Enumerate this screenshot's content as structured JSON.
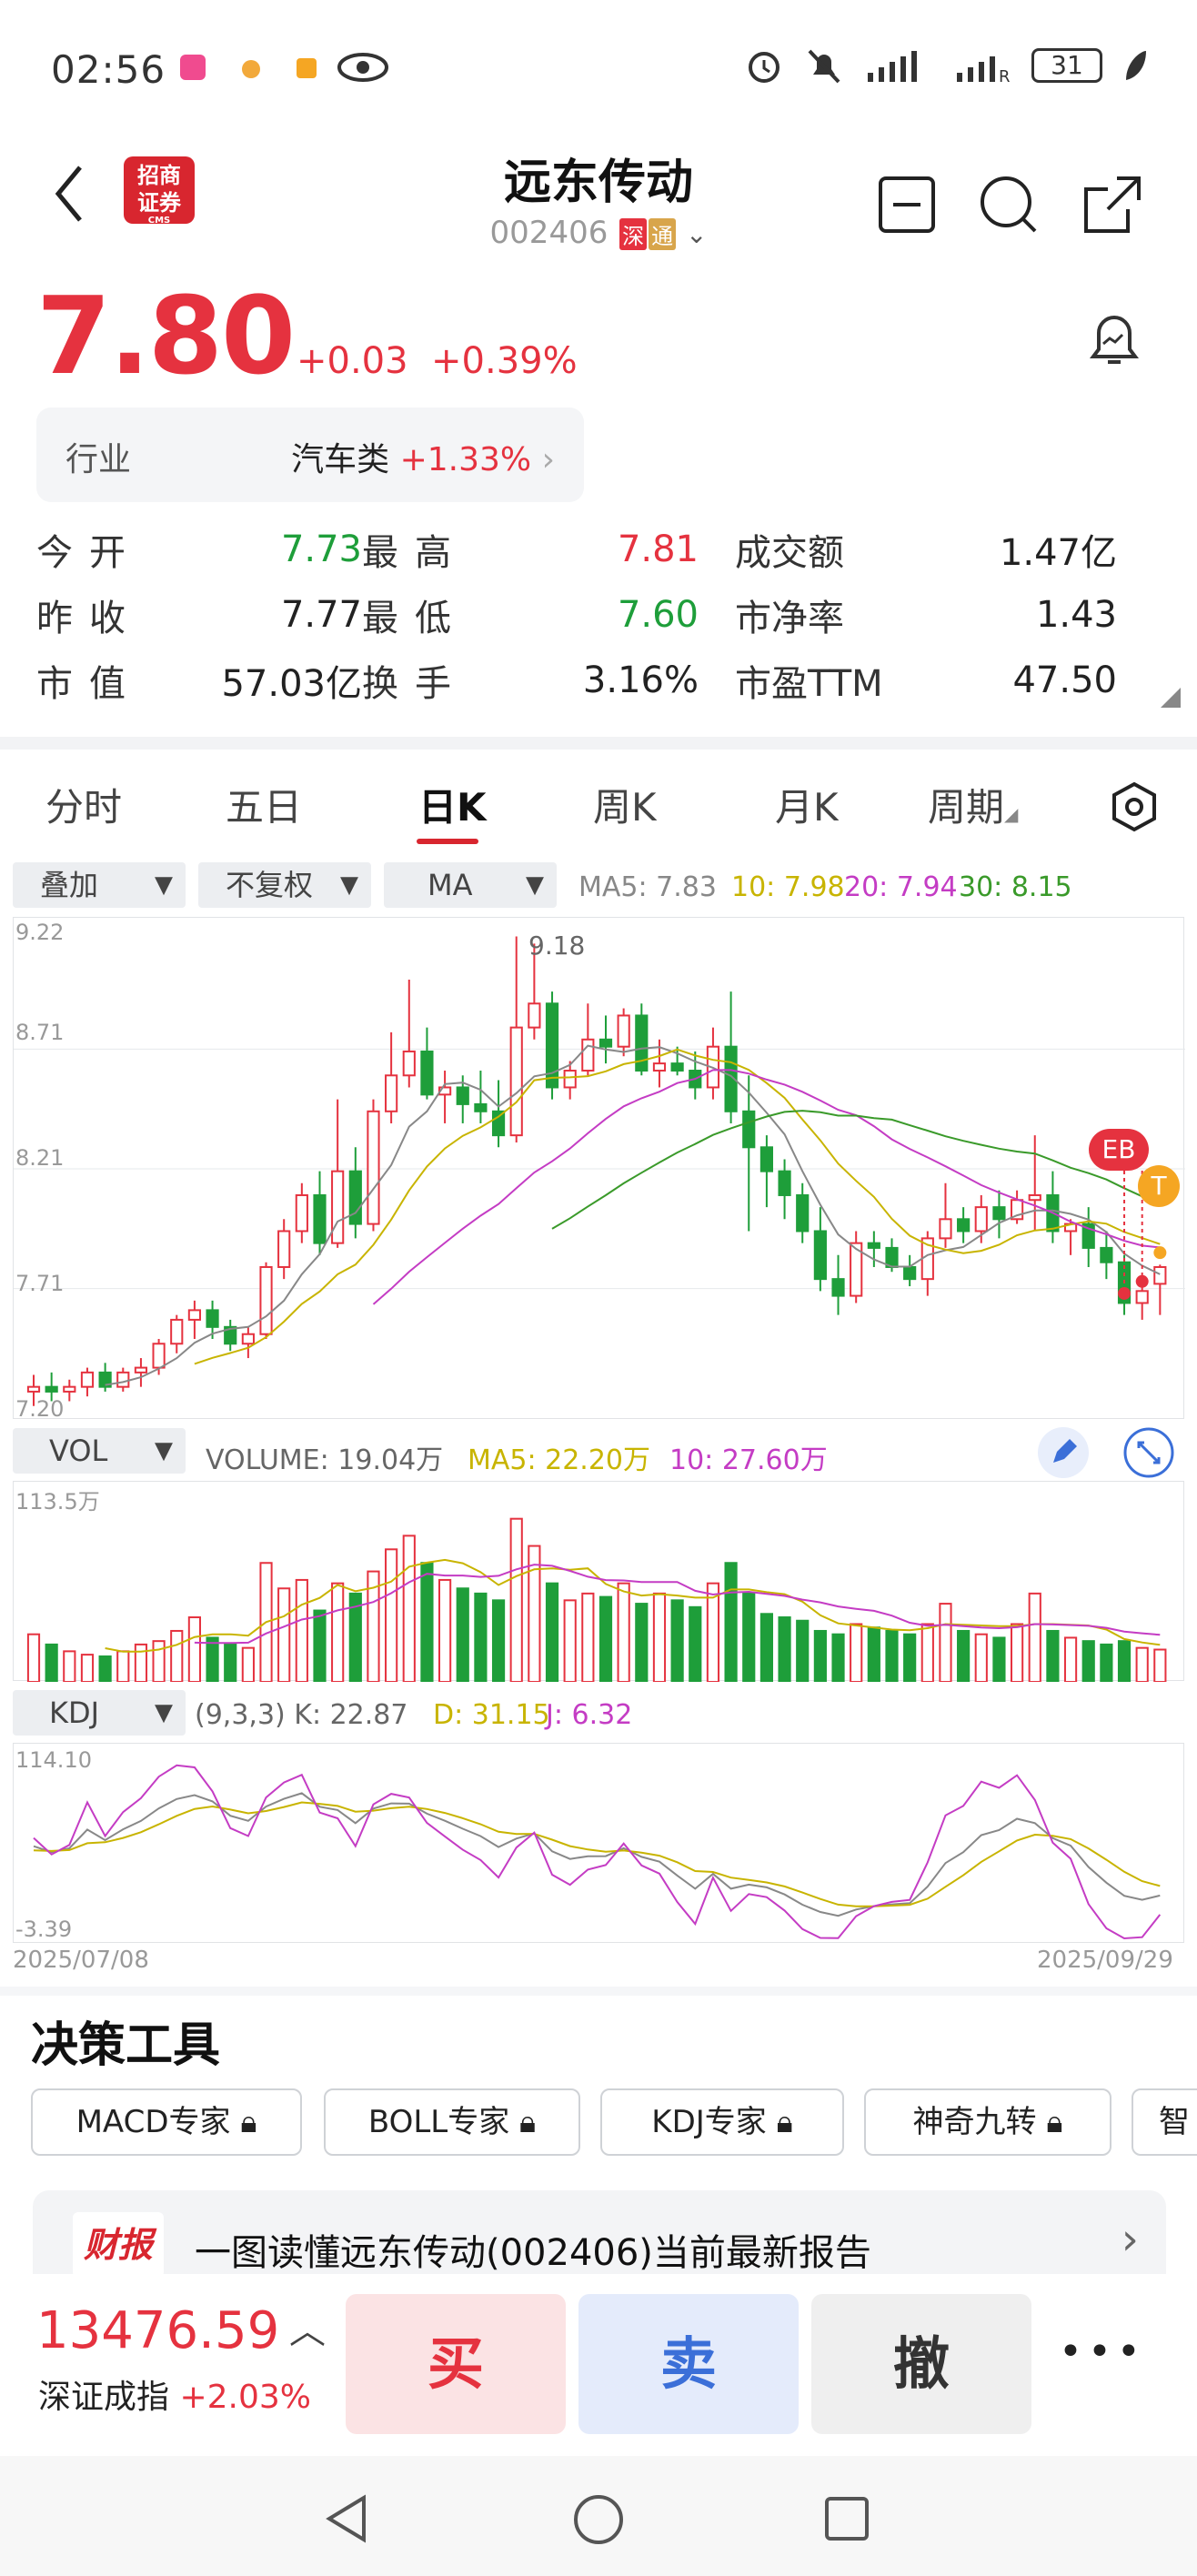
{
  "status_bar": {
    "time": "02:56",
    "battery": "31",
    "signal_label": "R"
  },
  "header": {
    "title": "远东传动",
    "code": "002406",
    "tag_shen": "深",
    "tag_tong": "通",
    "logo_text": "招商证券",
    "logo_sub": "CMS"
  },
  "quote": {
    "price": "7.80",
    "change": "+0.03",
    "change_pct": "+0.39%"
  },
  "industry": {
    "label": "行业",
    "name": "汽车类",
    "pct": "+1.33%"
  },
  "stats": [
    [
      {
        "label": "今开",
        "value": "7.73",
        "color": "green"
      },
      {
        "label": "最高",
        "value": "7.81",
        "color": "red"
      },
      {
        "label": "成交额",
        "value": "1.47亿",
        "color": "dark"
      }
    ],
    [
      {
        "label": "昨收",
        "value": "7.77",
        "color": "dark"
      },
      {
        "label": "最低",
        "value": "7.60",
        "color": "green"
      },
      {
        "label": "市净率",
        "value": "1.43",
        "color": "dark"
      }
    ],
    [
      {
        "label": "市值",
        "value": "57.03亿",
        "color": "dark"
      },
      {
        "label": "换手",
        "value": "3.16%",
        "color": "dark"
      },
      {
        "label": "市盈TTM",
        "value": "47.50",
        "color": "dark"
      }
    ]
  ],
  "tabs": [
    "分时",
    "五日",
    "日K",
    "周K",
    "月K",
    "周期"
  ],
  "chart_controls": {
    "overlay": "叠加",
    "adjust": "不复权",
    "ma": "MA"
  },
  "ma_legend": {
    "ma5": "MA5: 7.83",
    "ma10": "10: 7.98",
    "ma20": "20: 7.94",
    "ma30": "30: 8.15"
  },
  "main_axis": {
    "top": "9.22",
    "l2": "8.71",
    "l3": "8.21",
    "l4": "7.71",
    "bottom": "7.20",
    "peak": "9.18"
  },
  "markers": {
    "eb": "EB",
    "t": "T"
  },
  "vol_legend": {
    "selector": "VOL",
    "volume": "VOLUME: 19.04万",
    "ma5": "MA5: 22.20万",
    "ma10": "10: 27.60万",
    "top": "113.5万"
  },
  "kdj_legend": {
    "selector": "KDJ",
    "params": "(9,3,3) K: 22.87",
    "d": "D: 31.15",
    "j": "J: 6.32",
    "top": "114.10",
    "bottom": "-3.39"
  },
  "dates": {
    "start": "2025/07/08",
    "end": "2025/09/29"
  },
  "tools": {
    "title": "决策工具",
    "chips": [
      "MACD专家",
      "BOLL专家",
      "KDJ专家",
      "神奇九转",
      "智"
    ]
  },
  "report": {
    "badge": "财报",
    "text": "一图读懂远东传动(002406)当前最新报告"
  },
  "index": {
    "value": "13476.59",
    "name": "深证成指",
    "pct": "+2.03%"
  },
  "trade": {
    "buy": "买",
    "sell": "卖",
    "cancel": "撤",
    "more": "•••"
  },
  "colors": {
    "up": "#e5323f",
    "down": "#1e9e3a",
    "ma5": "#888888",
    "ma10": "#c8b400",
    "ma20": "#c43cc4",
    "ma30": "#3a9a2a"
  },
  "chart_data": {
    "type": "candlestick",
    "ohlc": [
      [
        7.28,
        7.35,
        7.22,
        7.3
      ],
      [
        7.3,
        7.36,
        7.24,
        7.28
      ],
      [
        7.28,
        7.33,
        7.24,
        7.3
      ],
      [
        7.3,
        7.38,
        7.26,
        7.36
      ],
      [
        7.36,
        7.4,
        7.28,
        7.3
      ],
      [
        7.3,
        7.38,
        7.28,
        7.36
      ],
      [
        7.36,
        7.42,
        7.3,
        7.38
      ],
      [
        7.38,
        7.5,
        7.35,
        7.48
      ],
      [
        7.48,
        7.6,
        7.44,
        7.58
      ],
      [
        7.58,
        7.66,
        7.5,
        7.62
      ],
      [
        7.62,
        7.66,
        7.5,
        7.55
      ],
      [
        7.55,
        7.58,
        7.45,
        7.48
      ],
      [
        7.48,
        7.55,
        7.42,
        7.52
      ],
      [
        7.52,
        7.82,
        7.5,
        7.8
      ],
      [
        7.8,
        8.0,
        7.75,
        7.95
      ],
      [
        7.95,
        8.15,
        7.9,
        8.1
      ],
      [
        8.1,
        8.2,
        7.85,
        7.9
      ],
      [
        7.9,
        8.5,
        7.88,
        8.2
      ],
      [
        8.2,
        8.3,
        7.92,
        7.98
      ],
      [
        7.98,
        8.5,
        7.95,
        8.45
      ],
      [
        8.45,
        8.78,
        8.4,
        8.6
      ],
      [
        8.6,
        9.0,
        8.55,
        8.7
      ],
      [
        8.7,
        8.8,
        8.5,
        8.52
      ],
      [
        8.52,
        8.62,
        8.4,
        8.55
      ],
      [
        8.55,
        8.6,
        8.4,
        8.48
      ],
      [
        8.48,
        8.62,
        8.4,
        8.45
      ],
      [
        8.45,
        8.58,
        8.3,
        8.35
      ],
      [
        8.35,
        9.18,
        8.32,
        8.8
      ],
      [
        8.8,
        9.15,
        8.75,
        8.9
      ],
      [
        8.9,
        8.95,
        8.5,
        8.55
      ],
      [
        8.55,
        8.66,
        8.5,
        8.62
      ],
      [
        8.62,
        8.9,
        8.6,
        8.75
      ],
      [
        8.75,
        8.85,
        8.65,
        8.72
      ],
      [
        8.72,
        8.88,
        8.68,
        8.85
      ],
      [
        8.85,
        8.9,
        8.6,
        8.62
      ],
      [
        8.62,
        8.75,
        8.55,
        8.65
      ],
      [
        8.65,
        8.72,
        8.6,
        8.62
      ],
      [
        8.62,
        8.7,
        8.5,
        8.55
      ],
      [
        8.55,
        8.8,
        8.5,
        8.72
      ],
      [
        8.72,
        8.95,
        8.4,
        8.45
      ],
      [
        8.45,
        8.6,
        7.95,
        8.3
      ],
      [
        8.3,
        8.35,
        8.05,
        8.2
      ],
      [
        8.2,
        8.25,
        8.0,
        8.1
      ],
      [
        8.1,
        8.15,
        7.9,
        7.95
      ],
      [
        7.95,
        8.05,
        7.7,
        7.75
      ],
      [
        7.75,
        7.85,
        7.6,
        7.68
      ],
      [
        7.68,
        7.95,
        7.65,
        7.9
      ],
      [
        7.9,
        7.95,
        7.8,
        7.88
      ],
      [
        7.88,
        7.92,
        7.78,
        7.8
      ],
      [
        7.8,
        7.85,
        7.72,
        7.75
      ],
      [
        7.75,
        7.95,
        7.68,
        7.92
      ],
      [
        7.92,
        8.15,
        7.88,
        8.0
      ],
      [
        8.0,
        8.05,
        7.9,
        7.95
      ],
      [
        7.95,
        8.1,
        7.9,
        8.05
      ],
      [
        8.05,
        8.12,
        7.92,
        8.0
      ],
      [
        8.0,
        8.12,
        7.98,
        8.08
      ],
      [
        8.08,
        8.35,
        7.95,
        8.1
      ],
      [
        8.1,
        8.2,
        7.9,
        7.95
      ],
      [
        7.95,
        8.0,
        7.85,
        7.98
      ],
      [
        7.98,
        8.05,
        7.8,
        7.88
      ],
      [
        7.88,
        7.95,
        7.75,
        7.82
      ],
      [
        7.82,
        7.85,
        7.6,
        7.65
      ],
      [
        7.65,
        7.72,
        7.58,
        7.7
      ],
      [
        7.73,
        7.81,
        7.6,
        7.8
      ]
    ],
    "volume": [
      28,
      22,
      18,
      16,
      15,
      18,
      22,
      24,
      30,
      38,
      26,
      22,
      20,
      70,
      55,
      60,
      42,
      58,
      52,
      65,
      78,
      86,
      70,
      60,
      55,
      52,
      48,
      96,
      80,
      58,
      48,
      52,
      50,
      58,
      46,
      52,
      48,
      44,
      58,
      70,
      52,
      40,
      38,
      36,
      30,
      28,
      34,
      32,
      30,
      28,
      34,
      46,
      30,
      28,
      26,
      34,
      52,
      30,
      26,
      24,
      22,
      24,
      20,
      19
    ],
    "ylim": [
      7.2,
      9.22
    ],
    "vol_ylim": [
      0,
      113.5
    ],
    "kdj_ylim": [
      -3.39,
      114.1
    ]
  }
}
